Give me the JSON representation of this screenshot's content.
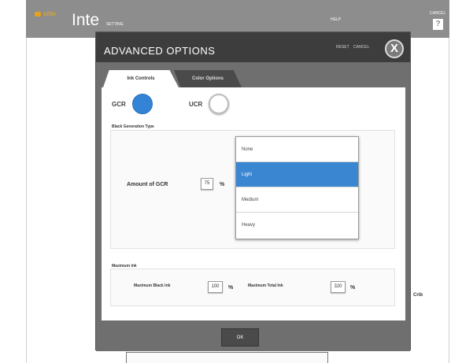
{
  "app": {
    "logo_text": "sitie",
    "title": "Inte",
    "menu_labels": [
      "SETTING",
      "HELP",
      "CANCEL"
    ],
    "help_glyph": "?",
    "side_text": "Crib"
  },
  "modal": {
    "title": "ADVANCED OPTIONS",
    "header_labels": [
      "RESET",
      "CANCEL"
    ],
    "close_glyph": "X",
    "tabs": [
      {
        "label": "Ink Controls",
        "active": true
      },
      {
        "label": "Color Options",
        "active": false
      }
    ],
    "radios": [
      {
        "label": "GCR",
        "selected": true
      },
      {
        "label": "UCR",
        "selected": false
      }
    ],
    "black_section_title": "Black Generation Type",
    "gcr_amount_label": "Amount of GCR",
    "gcr_amount_value": "75",
    "gcr_amount_unit": "%",
    "gcr_options": [
      "None",
      "Light",
      "Medium",
      "Heavy"
    ],
    "gcr_selected": "Light",
    "max_ink_section_title": "Maximum Ink",
    "max_black_label": "Maximum Black Ink",
    "max_black_value": "100",
    "max_black_unit": "%",
    "max_total_label": "Maximum Total Ink",
    "max_total_value": "320",
    "max_total_unit": "%",
    "ok_label": "OK"
  },
  "colors": {
    "accent": "#3383d6",
    "selected_row": "#3a86d1",
    "header_bg": "#3d3d3d",
    "modal_bg": "#6f6f6f",
    "app_bar": "#8d8d8d",
    "logo": "#e7a21a"
  }
}
